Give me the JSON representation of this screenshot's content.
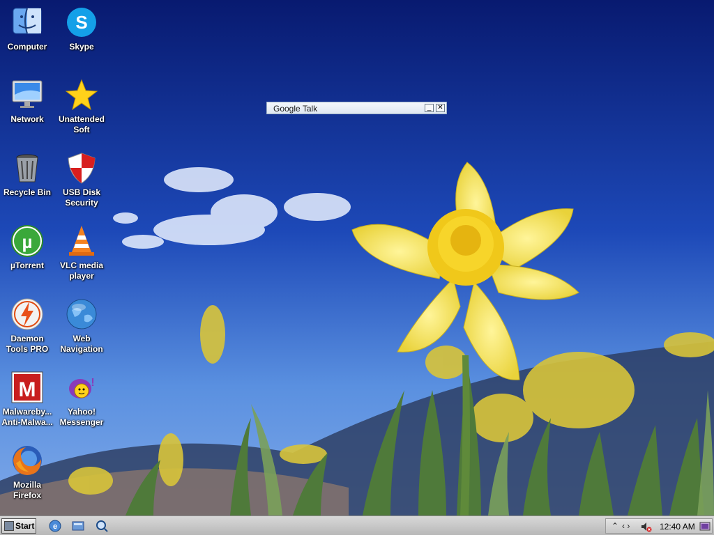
{
  "desktop": {
    "icons": [
      {
        "label": "Computer",
        "icon": "finder-icon"
      },
      {
        "label": "Skype",
        "icon": "skype-icon"
      },
      {
        "label": "Network",
        "icon": "monitor-icon"
      },
      {
        "label": "Unattended Soft",
        "icon": "star-icon"
      },
      {
        "label": "Recycle Bin",
        "icon": "trash-icon"
      },
      {
        "label": "USB Disk Security",
        "icon": "shield-icon"
      },
      {
        "label": "µTorrent",
        "icon": "utorrent-icon"
      },
      {
        "label": "VLC media player",
        "icon": "vlc-cone-icon"
      },
      {
        "label": "Daemon Tools PRO",
        "icon": "daemon-tools-icon"
      },
      {
        "label": "Web Navigation",
        "icon": "globe-icon"
      },
      {
        "label": "Malwareby... Anti-Malwa...",
        "icon": "malwarebytes-icon"
      },
      {
        "label": "Yahoo! Messenger",
        "icon": "yahoo-messenger-icon"
      },
      {
        "label": "Mozilla Firefox",
        "icon": "firefox-icon"
      }
    ]
  },
  "gtalk": {
    "title": "Google Talk",
    "minimize": "_",
    "close": "✕"
  },
  "taskbar": {
    "start_label": "Start",
    "quicklaunch": [
      "ie-icon",
      "explorer-icon",
      "search-icon"
    ],
    "tray": {
      "chevron": "⌃",
      "arrows": "‹ ›",
      "clock": "12:40 AM"
    }
  },
  "colors": {
    "sky_top": "#0a1e7a",
    "sky_bottom": "#4a88e0",
    "flower": "#f2e04a"
  }
}
